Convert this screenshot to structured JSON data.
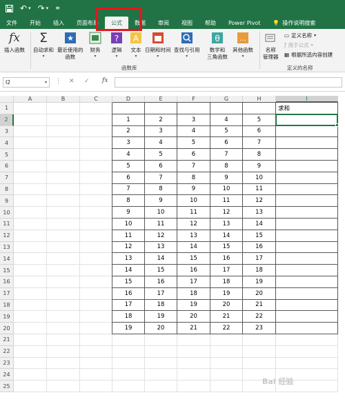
{
  "titlebar": {
    "save_icon": "save-icon",
    "undo_icon": "undo-icon",
    "redo_icon": "redo-icon",
    "customize_icon": "customize-icon"
  },
  "tabs": [
    {
      "label": "文件",
      "active": false
    },
    {
      "label": "开始",
      "active": false
    },
    {
      "label": "插入",
      "active": false
    },
    {
      "label": "页面布局",
      "active": false
    },
    {
      "label": "公式",
      "active": true
    },
    {
      "label": "数据",
      "active": false
    },
    {
      "label": "审阅",
      "active": false
    },
    {
      "label": "视图",
      "active": false
    },
    {
      "label": "帮助",
      "active": false
    },
    {
      "label": "Power Pivot",
      "active": false
    },
    {
      "label": "操作说明搜索",
      "active": false
    }
  ],
  "ribbon": {
    "insert_function": "插入函数",
    "autosum": "自动求和",
    "recent": "最近使用的",
    "recent2": "函数",
    "financial": "财务",
    "logical": "逻辑",
    "text": "文本",
    "datetime": "日期和时间",
    "lookup": "查找与引用",
    "math": "数学和",
    "math2": "三角函数",
    "more": "其他函数",
    "library_label": "函数库",
    "name_manager": "名称",
    "name_manager2": "管理器",
    "define_name": "定义名称",
    "use_in_formula": "用于公式",
    "create_from_selection": "根据所选内容创建",
    "defined_names_label": "定义的名称"
  },
  "formula_bar": {
    "name_box": "I2",
    "cancel": "✕",
    "enter": "✓",
    "fx": "fx",
    "value": ""
  },
  "columns": [
    "A",
    "B",
    "C",
    "D",
    "E",
    "F",
    "G",
    "H",
    "I"
  ],
  "rows": [
    "1",
    "2",
    "3",
    "4",
    "5",
    "6",
    "7",
    "8",
    "9",
    "10",
    "11",
    "12",
    "13",
    "14",
    "15",
    "16",
    "17",
    "18",
    "19",
    "20",
    "21",
    "22",
    "23",
    "24",
    "25"
  ],
  "header_cell": "求和",
  "table": [
    [
      "1",
      "2",
      "3",
      "4",
      "5"
    ],
    [
      "2",
      "3",
      "4",
      "5",
      "6"
    ],
    [
      "3",
      "4",
      "5",
      "6",
      "7"
    ],
    [
      "4",
      "5",
      "6",
      "7",
      "8"
    ],
    [
      "5",
      "6",
      "7",
      "8",
      "9"
    ],
    [
      "6",
      "7",
      "8",
      "9",
      "10"
    ],
    [
      "7",
      "8",
      "9",
      "10",
      "11"
    ],
    [
      "8",
      "9",
      "10",
      "11",
      "12"
    ],
    [
      "9",
      "10",
      "11",
      "12",
      "13"
    ],
    [
      "10",
      "11",
      "12",
      "13",
      "14"
    ],
    [
      "11",
      "12",
      "13",
      "14",
      "15"
    ],
    [
      "12",
      "13",
      "14",
      "15",
      "16"
    ],
    [
      "13",
      "14",
      "15",
      "16",
      "17"
    ],
    [
      "14",
      "15",
      "16",
      "17",
      "18"
    ],
    [
      "15",
      "16",
      "17",
      "18",
      "19"
    ],
    [
      "16",
      "17",
      "18",
      "19",
      "20"
    ],
    [
      "17",
      "18",
      "19",
      "20",
      "21"
    ],
    [
      "18",
      "19",
      "20",
      "21",
      "22"
    ],
    [
      "19",
      "20",
      "21",
      "22",
      "23"
    ]
  ],
  "accent_color": "#217346",
  "highlight_color": "#e8141c"
}
